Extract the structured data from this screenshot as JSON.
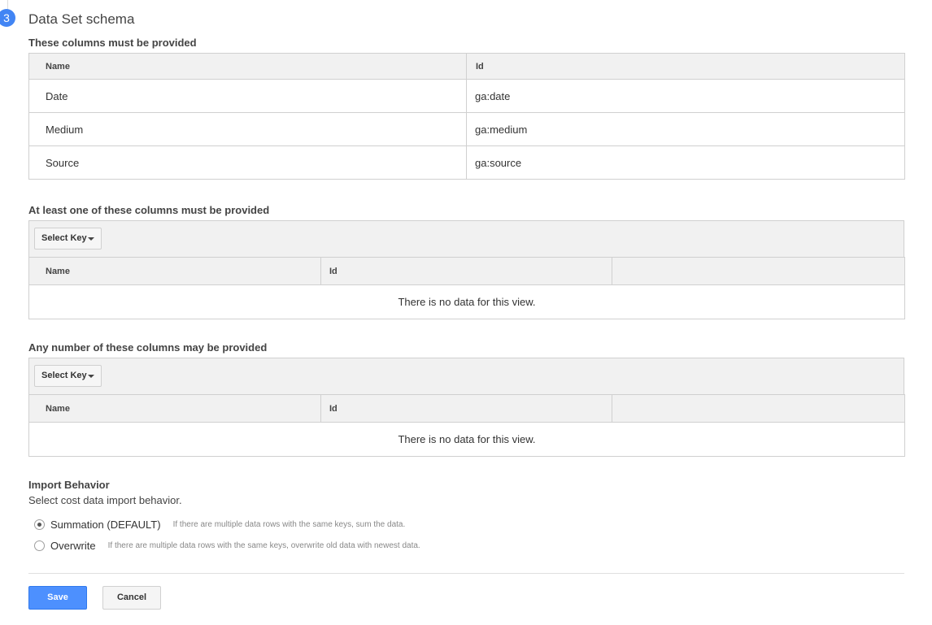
{
  "step": {
    "number": "3",
    "title": "Data Set schema"
  },
  "required": {
    "title": "These columns must be provided",
    "headers": {
      "name": "Name",
      "id": "Id"
    },
    "rows": [
      {
        "name": "Date",
        "id": "ga:date"
      },
      {
        "name": "Medium",
        "id": "ga:medium"
      },
      {
        "name": "Source",
        "id": "ga:source"
      }
    ]
  },
  "at_least_one": {
    "title": "At least one of these columns must be provided",
    "select_key_label": "Select Key",
    "headers": {
      "name": "Name",
      "id": "Id"
    },
    "empty_text": "There is no data for this view."
  },
  "any_number": {
    "title": "Any number of these columns may be provided",
    "select_key_label": "Select Key",
    "headers": {
      "name": "Name",
      "id": "Id"
    },
    "empty_text": "There is no data for this view."
  },
  "import_behavior": {
    "title": "Import Behavior",
    "subtitle": "Select cost data import behavior.",
    "options": [
      {
        "label": "Summation (DEFAULT)",
        "help": "If there are multiple data rows with the same keys, sum the data.",
        "selected": true
      },
      {
        "label": "Overwrite",
        "help": "If there are multiple data rows with the same keys, overwrite old data with newest data.",
        "selected": false
      }
    ]
  },
  "actions": {
    "save_label": "Save",
    "cancel_label": "Cancel"
  },
  "colors": {
    "accent": "#4285f4",
    "save_button": "#4d90fe"
  }
}
